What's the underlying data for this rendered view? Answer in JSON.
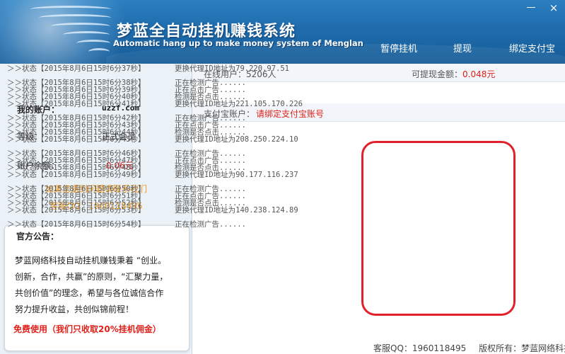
{
  "header": {
    "title": "梦蓝全自动挂机赚钱系统",
    "subtitle": "Automatic hang up to make money system of Menglan",
    "minimize": "—",
    "close": "×",
    "nav": {
      "pause": "暂停挂机",
      "withdraw": "提现",
      "bind_alipay": "绑定支付宝"
    }
  },
  "account": {
    "label_account": "我的账户：",
    "account_value": "uzzf.com",
    "label_level": "等级：",
    "level_value": "正式会员",
    "label_balance": "账户余额：",
    "balance_value": "0.06元",
    "help_text": "如果您遇到问题请联系我们",
    "qq_text": "客服QQ：1960118495"
  },
  "notice": {
    "title": "官方公告：",
    "line1": "梦蓝网络科技自动挂机赚钱秉着 “创业。",
    "line2": "创新，合作，共赢”的原则，“汇聚力量，",
    "line3": "共创价值”的理念，希望与各位诚信合作",
    "line4": "努力提升收益，共创似锦前程！",
    "free_use": "免费使用（我们只收取20%挂机佣金）"
  },
  "stats": {
    "online_label": "在线用户：5206人",
    "withdrawable_label": "可提现金额：",
    "withdrawable_value": "0.048元",
    "alipay_label": "支付宝账户：",
    "alipay_value": "请绑定支付宝账号"
  },
  "log": [
    {
      "status": "＞＞状态【2015年8月6日15时6分37秒】",
      "message": "更换代理ID地址为79.220.97.51"
    },
    {
      "status": "",
      "message": ""
    },
    {
      "status": "＞＞状态【2015年8月6日15时6分38秒】",
      "message": "正在检测广告......"
    },
    {
      "status": "＞＞状态【2015年8月6日15时6分39秒】",
      "message": "正在点击广告......"
    },
    {
      "status": "＞＞状态【2015年8月6日15时6分40秒】",
      "message": "检测是否点击......"
    },
    {
      "status": "＞＞状态【2015年8月6日15时6分41秒】",
      "message": "更换代理ID地址为221.105.170.226"
    },
    {
      "status": "",
      "message": ""
    },
    {
      "status": "＞＞状态【2015年8月6日15时6分42秒】",
      "message": "正在检测广告......"
    },
    {
      "status": "＞＞状态【2015年8月6日15时6分43秒】",
      "message": "正在点击广告......"
    },
    {
      "status": "＞＞状态【2015年8月6日15时6分44秒】",
      "message": "检测是否点击......"
    },
    {
      "status": "＞＞状态【2015年8月6日15时6分45秒】",
      "message": "更换代理ID地址为208.250.224.10"
    },
    {
      "status": "",
      "message": ""
    },
    {
      "status": "＞＞状态【2015年8月6日15时6分46秒】",
      "message": "正在检测广告......"
    },
    {
      "status": "＞＞状态【2015年8月6日15时6分47秒】",
      "message": "正在点击广告......"
    },
    {
      "status": "＞＞状态【2015年8月6日15时6分48秒】",
      "message": "检测是否点击......"
    },
    {
      "status": "＞＞状态【2015年8月6日15时6分49秒】",
      "message": "更换代理ID地址为90.177.116.237"
    },
    {
      "status": "",
      "message": ""
    },
    {
      "status": "＞＞状态【2015年8月6日15时6分50秒】",
      "message": "正在检测广告......"
    },
    {
      "status": "＞＞状态【2015年8月6日15时6分51秒】",
      "message": "正在点击广告......"
    },
    {
      "status": "＞＞状态【2015年8月6日15时6分52秒】",
      "message": "检测是否点击......"
    },
    {
      "status": "＞＞状态【2015年8月6日15时6分53秒】",
      "message": "更换代理ID地址为140.238.124.89"
    },
    {
      "status": "",
      "message": ""
    },
    {
      "status": "＞＞状态【2015年8月6日15时6分54秒】",
      "message": "正在检测广告......"
    }
  ],
  "footer": {
    "qq": "客服QQ：1960118495",
    "copyright": "版权所有：梦蓝网络科技"
  },
  "colors": {
    "header_blue": "#1f6cad",
    "accent_red": "#e0201a",
    "help_orange": "#f39a1d"
  }
}
